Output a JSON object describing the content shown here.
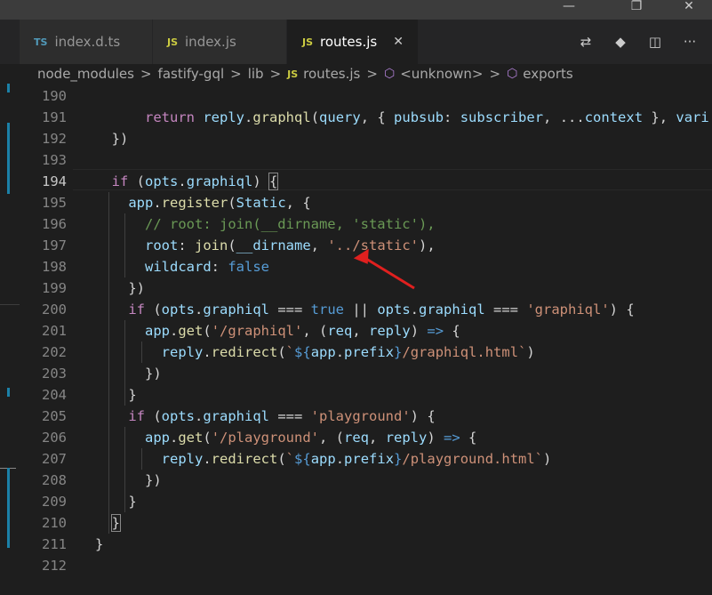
{
  "window": {
    "minimize_glyph": "—",
    "restore_glyph": "❐",
    "close_glyph": "✕"
  },
  "tabs": [
    {
      "icon_text": "TS",
      "label": "index.d.ts",
      "active": false
    },
    {
      "icon_text": "JS",
      "label": "index.js",
      "active": false
    },
    {
      "icon_text": "JS",
      "label": "routes.js",
      "active": true,
      "close_glyph": "✕"
    }
  ],
  "editor_actions": [
    {
      "icon": "compare-changes-icon",
      "glyph": "⇄"
    },
    {
      "icon": "git-icon",
      "glyph": "◆"
    },
    {
      "icon": "split-editor-icon",
      "glyph": "◫"
    },
    {
      "icon": "more-actions-icon",
      "glyph": "···"
    }
  ],
  "breadcrumb": {
    "items": [
      "node_modules",
      "fastify-gql",
      "lib",
      "routes.js",
      "<unknown>",
      "exports"
    ],
    "file_icon_text": "JS",
    "separator": ">"
  },
  "colors": {
    "keyword": "#c586c0",
    "function": "#dcdcaa",
    "variable": "#9cdcfe",
    "string": "#ce9178",
    "comment": "#6a9955",
    "boolean": "#569cd6",
    "arrow_annotation": "#e02020"
  },
  "code": {
    "active_line": "194",
    "lines": [
      {
        "n": "190",
        "tokens": []
      },
      {
        "n": "191",
        "tokens": [
          [
            "pu",
            "      "
          ],
          [
            "kw",
            "return"
          ],
          [
            "pu",
            " "
          ],
          [
            "va",
            "reply"
          ],
          [
            "pu",
            "."
          ],
          [
            "fn",
            "graphql"
          ],
          [
            "pu",
            "("
          ],
          [
            "va",
            "query"
          ],
          [
            "pu",
            ", { "
          ],
          [
            "va",
            "pubsub"
          ],
          [
            "pu",
            ": "
          ],
          [
            "va",
            "subscriber"
          ],
          [
            "pu",
            ", ..."
          ],
          [
            "va",
            "context"
          ],
          [
            "pu",
            " }, "
          ],
          [
            "va",
            "vari"
          ]
        ]
      },
      {
        "n": "192",
        "tokens": [
          [
            "pu",
            "  })"
          ]
        ]
      },
      {
        "n": "193",
        "tokens": []
      },
      {
        "n": "194",
        "tokens": [
          [
            "pu",
            "  "
          ],
          [
            "kw",
            "if"
          ],
          [
            "pu",
            " ("
          ],
          [
            "va",
            "opts"
          ],
          [
            "pu",
            "."
          ],
          [
            "va",
            "graphiql"
          ],
          [
            "pu",
            ") "
          ],
          [
            "box",
            "{"
          ]
        ]
      },
      {
        "n": "195",
        "tokens": [
          [
            "pu",
            "    "
          ],
          [
            "va",
            "app"
          ],
          [
            "pu",
            "."
          ],
          [
            "fn",
            "register"
          ],
          [
            "pu",
            "("
          ],
          [
            "va",
            "Static"
          ],
          [
            "pu",
            ", {"
          ]
        ]
      },
      {
        "n": "196",
        "tokens": [
          [
            "pu",
            "      "
          ],
          [
            "cm",
            "// root: join(__dirname, 'static'),"
          ]
        ]
      },
      {
        "n": "197",
        "tokens": [
          [
            "pu",
            "      "
          ],
          [
            "va",
            "root"
          ],
          [
            "pu",
            ": "
          ],
          [
            "fn",
            "join"
          ],
          [
            "pu",
            "("
          ],
          [
            "va",
            "__dirname"
          ],
          [
            "pu",
            ", "
          ],
          [
            "st",
            "'../static'"
          ],
          [
            "pu",
            "),"
          ]
        ]
      },
      {
        "n": "198",
        "tokens": [
          [
            "pu",
            "      "
          ],
          [
            "va",
            "wildcard"
          ],
          [
            "pu",
            ": "
          ],
          [
            "bl",
            "false"
          ]
        ]
      },
      {
        "n": "199",
        "tokens": [
          [
            "pu",
            "    })"
          ]
        ]
      },
      {
        "n": "200",
        "tokens": [
          [
            "pu",
            "    "
          ],
          [
            "kw",
            "if"
          ],
          [
            "pu",
            " ("
          ],
          [
            "va",
            "opts"
          ],
          [
            "pu",
            "."
          ],
          [
            "va",
            "graphiql"
          ],
          [
            "pu",
            " === "
          ],
          [
            "bl",
            "true"
          ],
          [
            "pu",
            " || "
          ],
          [
            "va",
            "opts"
          ],
          [
            "pu",
            "."
          ],
          [
            "va",
            "graphiql"
          ],
          [
            "pu",
            " === "
          ],
          [
            "st",
            "'graphiql'"
          ],
          [
            "pu",
            ") {"
          ]
        ]
      },
      {
        "n": "201",
        "tokens": [
          [
            "pu",
            "      "
          ],
          [
            "va",
            "app"
          ],
          [
            "pu",
            "."
          ],
          [
            "fn",
            "get"
          ],
          [
            "pu",
            "("
          ],
          [
            "st",
            "'/graphiql'"
          ],
          [
            "pu",
            ", ("
          ],
          [
            "va",
            "req"
          ],
          [
            "pu",
            ", "
          ],
          [
            "va",
            "reply"
          ],
          [
            "pu",
            ") "
          ],
          [
            "bl",
            "=>"
          ],
          [
            "pu",
            " {"
          ]
        ]
      },
      {
        "n": "202",
        "tokens": [
          [
            "pu",
            "        "
          ],
          [
            "va",
            "reply"
          ],
          [
            "pu",
            "."
          ],
          [
            "fn",
            "redirect"
          ],
          [
            "pu",
            "("
          ],
          [
            "st",
            "`"
          ],
          [
            "bl",
            "${"
          ],
          [
            "va",
            "app"
          ],
          [
            "pu",
            "."
          ],
          [
            "va",
            "prefix"
          ],
          [
            "bl",
            "}"
          ],
          [
            "st",
            "/graphiql.html`"
          ],
          [
            "pu",
            ")"
          ]
        ]
      },
      {
        "n": "203",
        "tokens": [
          [
            "pu",
            "      })"
          ]
        ]
      },
      {
        "n": "204",
        "tokens": [
          [
            "pu",
            "    }"
          ]
        ]
      },
      {
        "n": "205",
        "tokens": [
          [
            "pu",
            "    "
          ],
          [
            "kw",
            "if"
          ],
          [
            "pu",
            " ("
          ],
          [
            "va",
            "opts"
          ],
          [
            "pu",
            "."
          ],
          [
            "va",
            "graphiql"
          ],
          [
            "pu",
            " === "
          ],
          [
            "st",
            "'playground'"
          ],
          [
            "pu",
            ") {"
          ]
        ]
      },
      {
        "n": "206",
        "tokens": [
          [
            "pu",
            "      "
          ],
          [
            "va",
            "app"
          ],
          [
            "pu",
            "."
          ],
          [
            "fn",
            "get"
          ],
          [
            "pu",
            "("
          ],
          [
            "st",
            "'/playground'"
          ],
          [
            "pu",
            ", ("
          ],
          [
            "va",
            "req"
          ],
          [
            "pu",
            ", "
          ],
          [
            "va",
            "reply"
          ],
          [
            "pu",
            ") "
          ],
          [
            "bl",
            "=>"
          ],
          [
            "pu",
            " {"
          ]
        ]
      },
      {
        "n": "207",
        "tokens": [
          [
            "pu",
            "        "
          ],
          [
            "va",
            "reply"
          ],
          [
            "pu",
            "."
          ],
          [
            "fn",
            "redirect"
          ],
          [
            "pu",
            "("
          ],
          [
            "st",
            "`"
          ],
          [
            "bl",
            "${"
          ],
          [
            "va",
            "app"
          ],
          [
            "pu",
            "."
          ],
          [
            "va",
            "prefix"
          ],
          [
            "bl",
            "}"
          ],
          [
            "st",
            "/playground.html`"
          ],
          [
            "pu",
            ")"
          ]
        ]
      },
      {
        "n": "208",
        "tokens": [
          [
            "pu",
            "      })"
          ]
        ]
      },
      {
        "n": "209",
        "tokens": [
          [
            "pu",
            "    }"
          ]
        ]
      },
      {
        "n": "210",
        "tokens": [
          [
            "pu",
            "  "
          ],
          [
            "box",
            "}"
          ]
        ]
      },
      {
        "n": "211",
        "tokens": [
          [
            "pu",
            "}"
          ]
        ]
      },
      {
        "n": "212",
        "tokens": []
      }
    ]
  }
}
